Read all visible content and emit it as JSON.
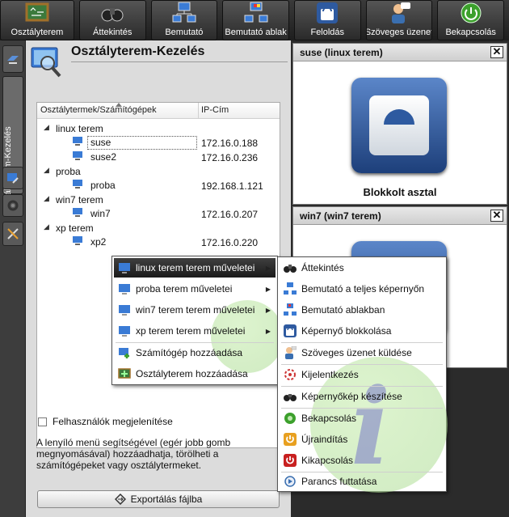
{
  "toolbar": {
    "buttons": [
      {
        "label": "Osztályterem",
        "icon": "chalkboard-icon"
      },
      {
        "label": "Áttekintés",
        "icon": "binoculars-icon"
      },
      {
        "label": "Bemutató",
        "icon": "network-monitors-icon"
      },
      {
        "label": "Bemutató ablak",
        "icon": "presentation-window-icon"
      },
      {
        "label": "Feloldás",
        "icon": "lock-icon"
      },
      {
        "label": "Szöveges üzenet",
        "icon": "user-message-icon"
      },
      {
        "label": "Bekapcsolás",
        "icon": "power-on-icon"
      }
    ]
  },
  "sidebar": {
    "vertical_label": "Osztályterem-Kezelés"
  },
  "panel": {
    "title": "Osztályterem-Kezelés",
    "tree": {
      "columns": [
        "Osztálytermek/Számítógépek",
        "IP-Cím"
      ],
      "rows": [
        {
          "type": "group",
          "label": "linux terem"
        },
        {
          "type": "pc",
          "label": "suse",
          "ip": "172.16.0.188",
          "selected": true
        },
        {
          "type": "pc",
          "label": "suse2",
          "ip": "172.16.0.236"
        },
        {
          "type": "group",
          "label": "proba"
        },
        {
          "type": "pc",
          "label": "proba",
          "ip": "192.168.1.121"
        },
        {
          "type": "group",
          "label": "win7 terem"
        },
        {
          "type": "pc",
          "label": "win7",
          "ip": "172.16.0.207"
        },
        {
          "type": "group",
          "label": "xp terem"
        },
        {
          "type": "pc",
          "label": "xp2",
          "ip": "172.16.0.220"
        }
      ]
    },
    "show_users_label": "Felhasználók megjelenítése",
    "help_text": "A lenyíló menü segítségével (egér jobb gomb megnyomásával) hozzáadhatja, törölheti a számítógépeket vagy osztálytermeket.",
    "export_label": "Exportálás fájlba"
  },
  "viewers": [
    {
      "title": "suse (linux terem)",
      "status": "Blokkolt asztal"
    },
    {
      "title": "win7 (win7 terem)"
    }
  ],
  "context_menu": {
    "items": [
      {
        "label": "linux terem terem műveletei",
        "submenu": true,
        "active": true
      },
      {
        "label": "proba terem műveletei",
        "submenu": true
      },
      {
        "label": "win7 terem terem műveletei",
        "submenu": true
      },
      {
        "label": "xp terem terem műveletei",
        "submenu": true
      },
      {
        "label": "Számítógép hozzáadása"
      },
      {
        "label": "Osztályterem hozzáadása"
      }
    ]
  },
  "submenu": {
    "items": [
      {
        "label": "Áttekintés",
        "icon": "binoculars-icon"
      },
      {
        "label": "Bemutató a teljes képernyőn",
        "icon": "network-monitors-icon"
      },
      {
        "label": "Bemutató ablakban",
        "icon": "presentation-window-icon"
      },
      {
        "label": "Képernyő blokkolása",
        "icon": "lock-icon"
      },
      {
        "label": "Szöveges üzenet küldése",
        "icon": "user-message-icon"
      },
      {
        "label": "Kijelentkezés",
        "icon": "logout-icon"
      },
      {
        "label": "Képernyőkép készítése",
        "icon": "camera-icon"
      },
      {
        "label": "Bekapcsolás",
        "icon": "power-on-icon"
      },
      {
        "label": "Újraindítás",
        "icon": "restart-icon"
      },
      {
        "label": "Kikapcsolás",
        "icon": "power-off-icon"
      },
      {
        "label": "Parancs futtatása",
        "icon": "run-command-icon"
      }
    ]
  },
  "colors": {
    "toolbar_bg": "#2a2a2a",
    "panel_bg": "#dcdcdc",
    "menu_active": "#262626",
    "lock_blue": "#2e5aa0"
  }
}
